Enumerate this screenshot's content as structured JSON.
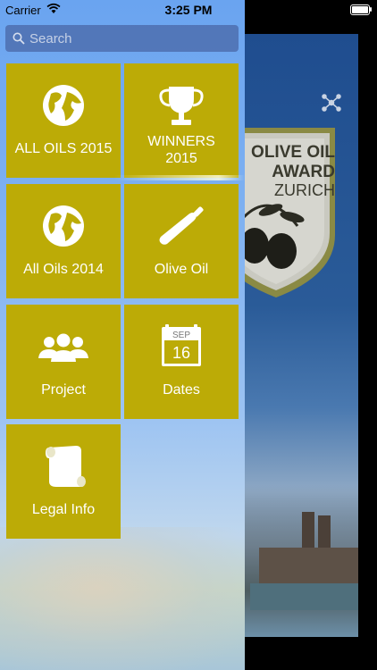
{
  "status_bar": {
    "carrier": "Carrier",
    "time": "3:25 PM",
    "battery_level": 1.0
  },
  "search": {
    "placeholder": "Search"
  },
  "menu": {
    "tiles": [
      {
        "label": "ALL OILS 2015",
        "icon": "globe-icon"
      },
      {
        "label": "WINNERS\n2015",
        "icon": "trophy-icon"
      },
      {
        "label": "All Oils 2014",
        "icon": "globe-icon"
      },
      {
        "label": "Olive Oil",
        "icon": "bottle-icon"
      },
      {
        "label": "Project",
        "icon": "people-icon"
      },
      {
        "label": "Dates",
        "icon": "calendar-icon",
        "calendar_month": "SEP",
        "calendar_day": "16"
      },
      {
        "label": "Legal Info",
        "icon": "scroll-icon"
      }
    ]
  },
  "background": {
    "badge": {
      "line1": "OLIVE OIL",
      "line2": "AWARD",
      "line3": "ZURICH"
    },
    "share_icon": "share-icon"
  },
  "colors": {
    "tile": "#bcab06",
    "menu_top": "#6aa4f0",
    "background_app": "#1f4d8f"
  }
}
